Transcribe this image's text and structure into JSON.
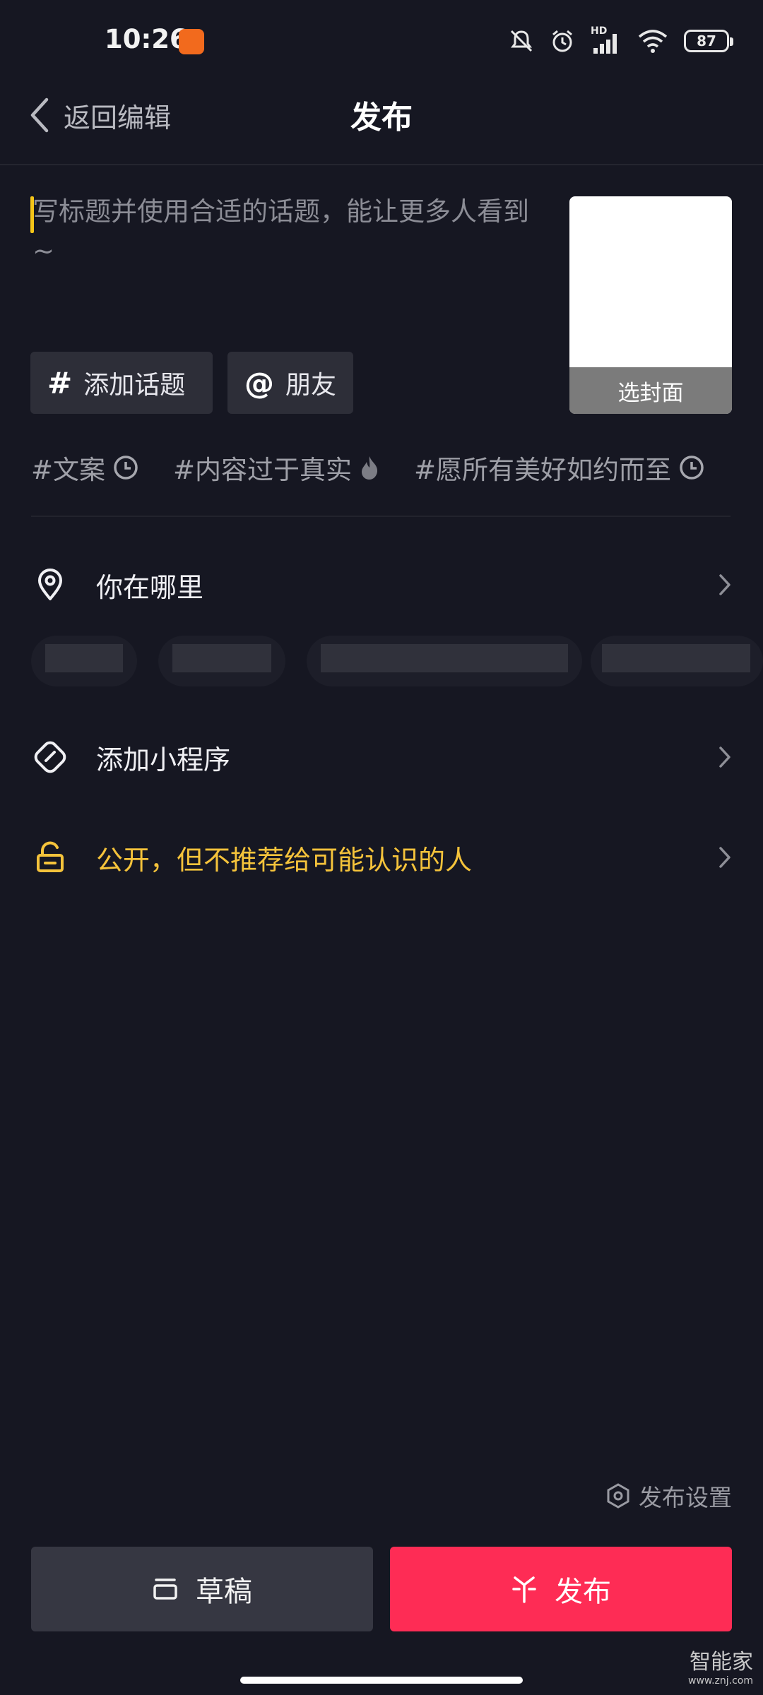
{
  "status_bar": {
    "time": "10:26",
    "signal_label": "HD",
    "battery": "87"
  },
  "header": {
    "back_label": "返回编辑",
    "title": "发布"
  },
  "caption": {
    "placeholder": "写标题并使用合适的话题，能让更多人看到 ~"
  },
  "cover": {
    "label": "选封面"
  },
  "chips": {
    "topic": {
      "symbol": "#",
      "label": "添加话题"
    },
    "friend": {
      "symbol": "@",
      "label": "朋友"
    }
  },
  "hashtags": [
    {
      "text": "#文案",
      "icon": "clock-icon"
    },
    {
      "text": "#内容过于真实",
      "icon": "fire-icon"
    },
    {
      "text": "#愿所有美好如约而至",
      "icon": "clock-icon"
    }
  ],
  "rows": {
    "location": "你在哪里",
    "miniapp": "添加小程序",
    "privacy": "公开，但不推荐给可能认识的人"
  },
  "footer": {
    "settings": "发布设置",
    "draft": "草稿",
    "publish": "发布"
  },
  "watermark": {
    "name": "智能家",
    "url": "www.znj.com"
  },
  "colors": {
    "background": "#161722",
    "publish": "#fe2c55",
    "privacy": "#f5c33b",
    "cursor": "#f5c518"
  }
}
